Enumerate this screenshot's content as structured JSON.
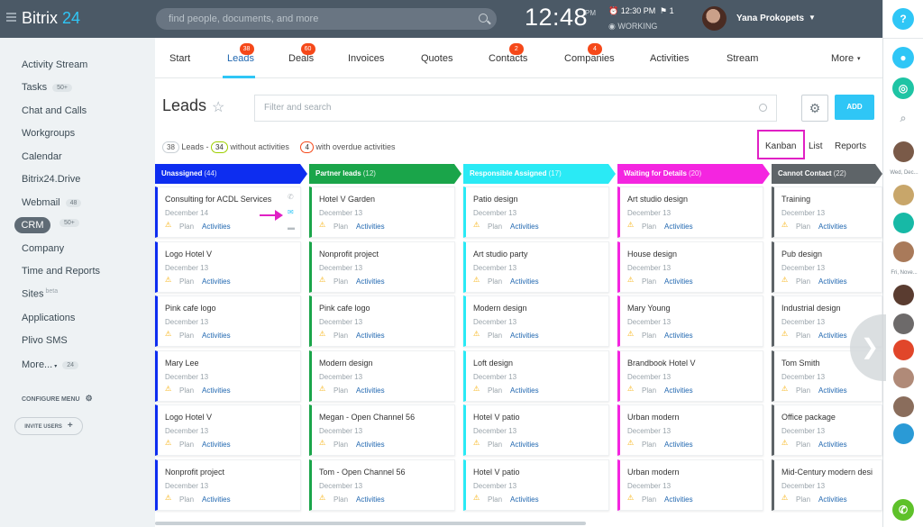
{
  "header": {
    "logo_main": "Bitrix",
    "logo_num": " 24",
    "search_placeholder": "find people, documents, and more",
    "clock": "12:48",
    "clock_ampm": "PM",
    "alarm": "12:30 PM",
    "flag_count": "1",
    "status": "WORKING",
    "user_name": "Yana Prokopets"
  },
  "sidebar": {
    "items": [
      {
        "label": "Activity Stream",
        "count": ""
      },
      {
        "label": "Tasks",
        "count": "50+"
      },
      {
        "label": "Chat and Calls",
        "count": ""
      },
      {
        "label": "Workgroups",
        "count": ""
      },
      {
        "label": "Calendar",
        "count": ""
      },
      {
        "label": "Bitrix24.Drive",
        "count": ""
      },
      {
        "label": "Webmail",
        "count": "48"
      },
      {
        "label": "CRM",
        "count": "50+"
      },
      {
        "label": "Company",
        "count": ""
      },
      {
        "label": "Time and Reports",
        "count": ""
      },
      {
        "label": "Sites",
        "count": ""
      },
      {
        "label": "Applications",
        "count": ""
      },
      {
        "label": "Plivo SMS",
        "count": ""
      },
      {
        "label": "More...",
        "count": "24"
      }
    ],
    "sites_beta": "beta",
    "configure_menu": "CONFIGURE MENU",
    "invite_users": "INVITE USERS"
  },
  "tabs": [
    {
      "label": "Start",
      "badge": ""
    },
    {
      "label": "Leads",
      "badge": "38"
    },
    {
      "label": "Deals",
      "badge": "60"
    },
    {
      "label": "Invoices",
      "badge": ""
    },
    {
      "label": "Quotes",
      "badge": ""
    },
    {
      "label": "Contacts",
      "badge": "2"
    },
    {
      "label": "Companies",
      "badge": "4"
    },
    {
      "label": "Activities",
      "badge": ""
    },
    {
      "label": "Stream",
      "badge": ""
    },
    {
      "label": "More",
      "badge": ""
    }
  ],
  "toolbar": {
    "title": "Leads",
    "filter_placeholder": "Filter and search",
    "add_label": "ADD"
  },
  "summary": {
    "leads_count": "38",
    "leads_label": "Leads -",
    "without_count": "34",
    "without_label": "without activities",
    "overdue_count": "4",
    "overdue_label": "with overdue activities"
  },
  "views": {
    "kanban": "Kanban",
    "list": "List",
    "reports": "Reports"
  },
  "card_labels": {
    "plan": "Plan",
    "activities": "Activities"
  },
  "columns": [
    {
      "name": "Unassigned",
      "count": "(44)",
      "color": "#0d2df0",
      "cards": [
        {
          "title": "Consulting for ACDL Services",
          "date": "December 14"
        },
        {
          "title": "Logo Hotel V",
          "date": "December 13"
        },
        {
          "title": "Pink cafe logo",
          "date": "December 13"
        },
        {
          "title": "Mary Lee",
          "date": "December 13"
        },
        {
          "title": "Logo Hotel V",
          "date": "December 13"
        },
        {
          "title": "Nonprofit project",
          "date": "December 13"
        }
      ]
    },
    {
      "name": "Partner leads",
      "count": "(12)",
      "color": "#1aa54a",
      "cards": [
        {
          "title": "Hotel V Garden",
          "date": "December 13"
        },
        {
          "title": "Nonprofit project",
          "date": "December 13"
        },
        {
          "title": "Pink cafe logo",
          "date": "December 13"
        },
        {
          "title": "Modern design",
          "date": "December 13"
        },
        {
          "title": "Megan - Open Channel 56",
          "date": "December 13"
        },
        {
          "title": "Tom - Open Channel 56",
          "date": "December 13"
        }
      ]
    },
    {
      "name": "Responsible Assigned",
      "count": "(17)",
      "color": "#2aeaf5",
      "cards": [
        {
          "title": "Patio design",
          "date": "December 13"
        },
        {
          "title": "Art studio party",
          "date": "December 13"
        },
        {
          "title": "Modern design",
          "date": "December 13"
        },
        {
          "title": "Loft design",
          "date": "December 13"
        },
        {
          "title": "Hotel V patio",
          "date": "December 13"
        },
        {
          "title": "Hotel V patio",
          "date": "December 13"
        }
      ]
    },
    {
      "name": "Waiting for Details",
      "count": "(20)",
      "color": "#f425e0",
      "cards": [
        {
          "title": "Art studio design",
          "date": "December 13"
        },
        {
          "title": "House design",
          "date": "December 13"
        },
        {
          "title": "Mary Young",
          "date": "December 13"
        },
        {
          "title": "Brandbook Hotel V",
          "date": "December 13"
        },
        {
          "title": "Urban modern",
          "date": "December 13"
        },
        {
          "title": "Urban modern",
          "date": "December 13"
        }
      ]
    },
    {
      "name": "Cannot Contact",
      "count": "(22)",
      "color": "#5e6468",
      "cards": [
        {
          "title": "Training",
          "date": "December 13"
        },
        {
          "title": "Pub design",
          "date": "December 13"
        },
        {
          "title": "Industrial design",
          "date": "December 13"
        },
        {
          "title": "Tom Smith",
          "date": "December 13"
        },
        {
          "title": "Office package",
          "date": "December 13"
        },
        {
          "title": "Mid-Century modern desi",
          "date": "December 13"
        }
      ]
    }
  ],
  "rail": {
    "help": "?",
    "label1": "Wed, Dec...",
    "label2": "Fri, Nove..."
  }
}
